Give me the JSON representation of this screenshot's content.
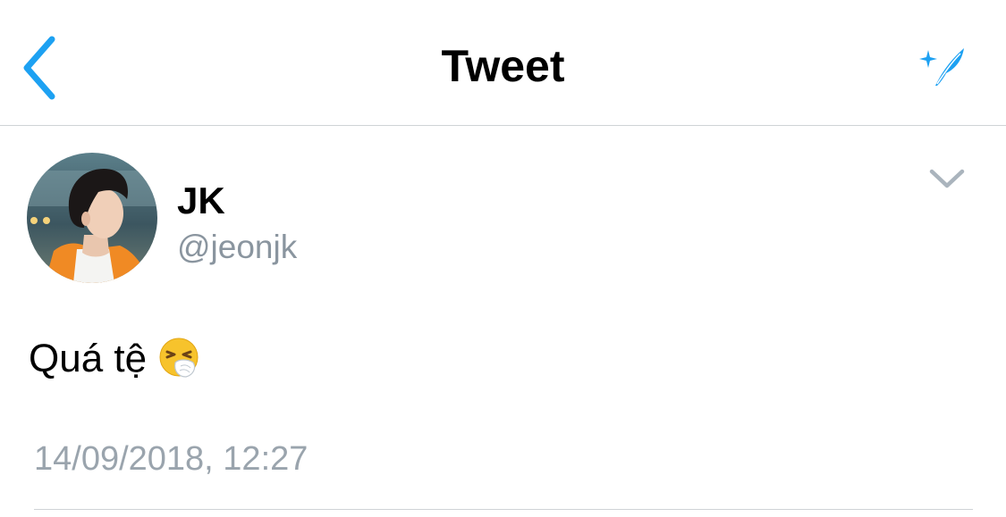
{
  "navbar": {
    "title": "Tweet",
    "back_icon": "chevron-left-icon",
    "compose_icon": "compose-feather-icon"
  },
  "tweet": {
    "author": {
      "display_name": "JK",
      "handle": "@jeonjk",
      "avatar": "avatar-photo"
    },
    "text": "Quá tệ",
    "emoji": "sneezing-face-emoji",
    "timestamp": "14/09/2018, 12:27",
    "menu_icon": "chevron-down-icon"
  },
  "colors": {
    "accent": "#1da1f2",
    "handle_gray": "#8a959f",
    "timestamp_gray": "#9aa4ad",
    "divider": "#cfd3d6"
  }
}
